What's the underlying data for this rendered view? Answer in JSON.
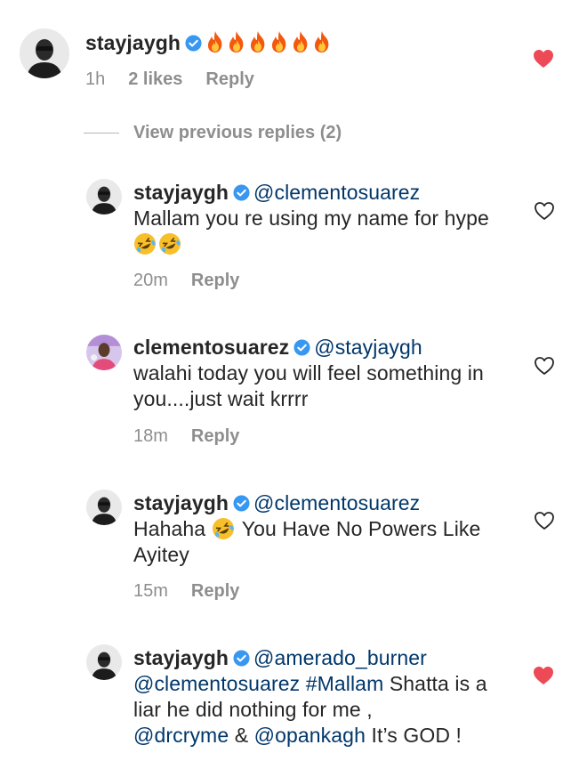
{
  "colors": {
    "text": "#262626",
    "muted": "#8e8e8e",
    "link": "#00376b",
    "verified": "#3897f0",
    "heart_filled": "#ed4956",
    "heart_outline": "#262626"
  },
  "top_comment": {
    "username": "stayjaygh",
    "verified": true,
    "emoji": [
      "fire",
      "fire",
      "fire",
      "fire",
      "fire",
      "fire"
    ],
    "time": "1h",
    "likes": "2 likes",
    "reply_label": "Reply",
    "liked": true,
    "avatar_icon": "profile-photo-icon"
  },
  "view_previous": "View previous replies (2)",
  "replies": [
    {
      "username": "stayjaygh",
      "mention": "@clementosuarez",
      "text": "Mallam you re using my name for hype",
      "trailing_emoji": [
        "rolling-on-floor-laughing",
        "rolling-on-floor-laughing"
      ],
      "time": "20m",
      "reply_label": "Reply",
      "liked": false
    },
    {
      "username": "clementosuarez",
      "mention": "@stayjaygh",
      "text": "walahi today you will feel something in you....just wait krrrr",
      "time": "18m",
      "reply_label": "Reply",
      "liked": false
    },
    {
      "username": "stayjaygh",
      "mention": "@clementosuarez",
      "text_before_emoji": "Hahaha",
      "emoji": "rolling-on-floor-laughing",
      "text_after_emoji": "You Have No Powers Like Ayitey",
      "time": "15m",
      "reply_label": "Reply",
      "liked": false
    },
    {
      "username": "stayjaygh",
      "mention1": "@amerado_burner",
      "mention2": "@clementosuarez",
      "hashtag": "#Mallam",
      "text1": "Shatta is a liar he did nothing for me ,",
      "mention3": "@drcryme",
      "amp": "&",
      "mention4": "@opankagh",
      "text2": "It’s GOD !",
      "liked": true
    }
  ]
}
